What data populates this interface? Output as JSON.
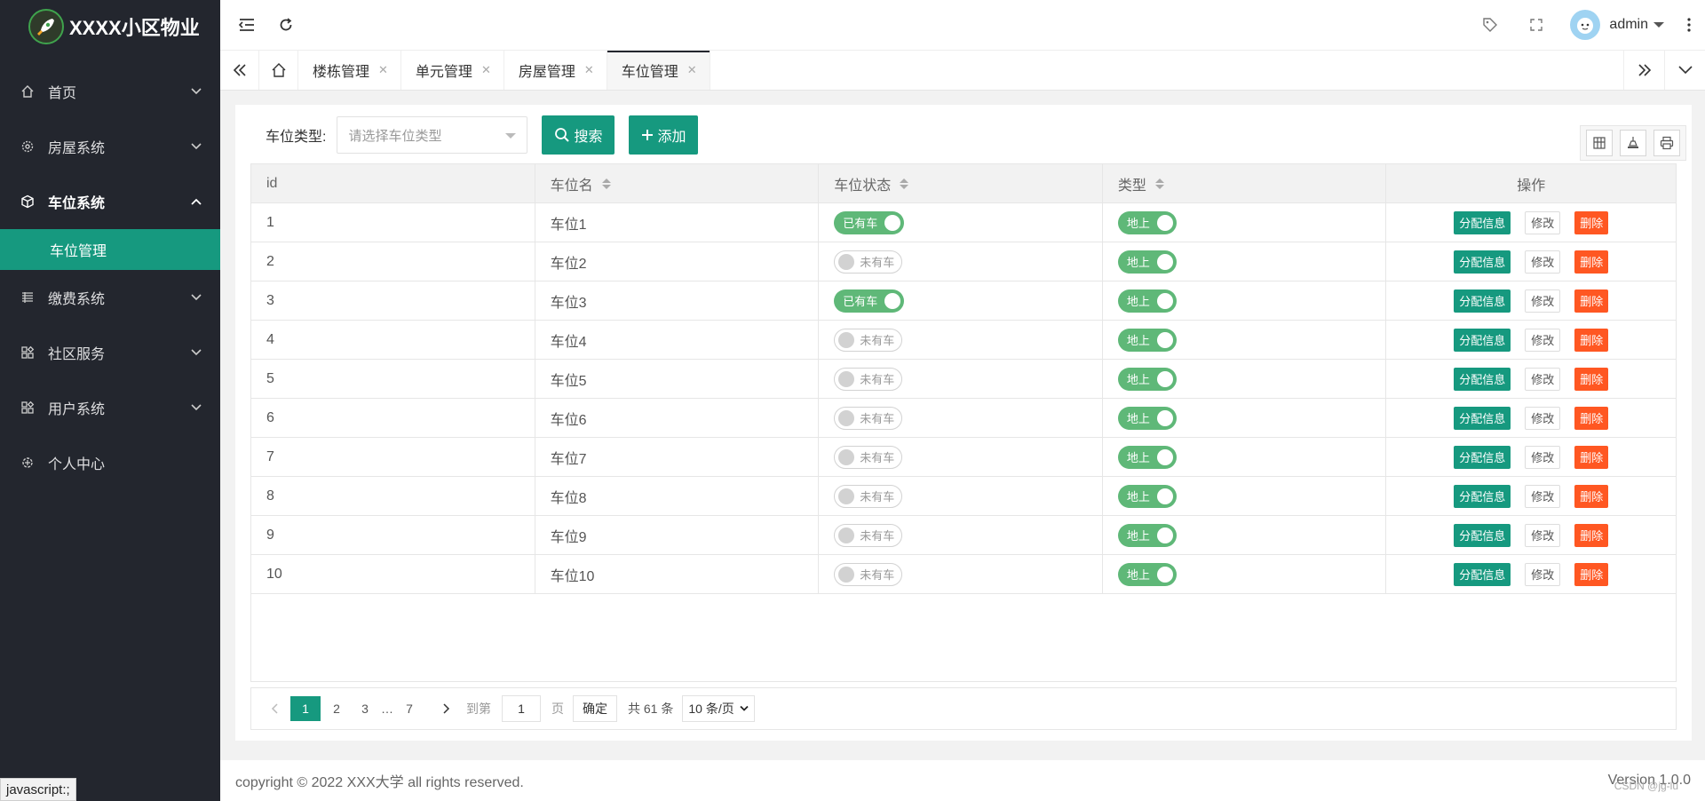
{
  "app": {
    "title": "XXXX小区物业"
  },
  "sidebar": {
    "items": [
      {
        "label": "首页",
        "icon": "home-icon",
        "arrow": "down"
      },
      {
        "label": "房屋系统",
        "icon": "gear-icon",
        "arrow": "down"
      },
      {
        "label": "车位系统",
        "icon": "cube-icon",
        "arrow": "up"
      },
      {
        "label": "缴费系统",
        "icon": "list-icon",
        "arrow": "down"
      },
      {
        "label": "社区服务",
        "icon": "apps-icon",
        "arrow": "down"
      },
      {
        "label": "用户系统",
        "icon": "apps-icon",
        "arrow": "down"
      },
      {
        "label": "个人中心",
        "icon": "settings-icon",
        "arrow": ""
      }
    ],
    "subitem": "车位管理"
  },
  "header": {
    "username": "admin"
  },
  "tabs": [
    {
      "label": "楼栋管理"
    },
    {
      "label": "单元管理"
    },
    {
      "label": "房屋管理"
    },
    {
      "label": "车位管理"
    }
  ],
  "search": {
    "label": "车位类型:",
    "placeholder": "请选择车位类型",
    "search_button": "搜索",
    "add_button": "添加"
  },
  "table": {
    "columns": [
      "id",
      "车位名",
      "车位状态",
      "类型",
      "操作"
    ],
    "rows": [
      {
        "id": "1",
        "name": "车位1",
        "status": "已有车",
        "status_on": true,
        "type": "地上"
      },
      {
        "id": "2",
        "name": "车位2",
        "status": "未有车",
        "status_on": false,
        "type": "地上"
      },
      {
        "id": "3",
        "name": "车位3",
        "status": "已有车",
        "status_on": true,
        "type": "地上"
      },
      {
        "id": "4",
        "name": "车位4",
        "status": "未有车",
        "status_on": false,
        "type": "地上"
      },
      {
        "id": "5",
        "name": "车位5",
        "status": "未有车",
        "status_on": false,
        "type": "地上"
      },
      {
        "id": "6",
        "name": "车位6",
        "status": "未有车",
        "status_on": false,
        "type": "地上"
      },
      {
        "id": "7",
        "name": "车位7",
        "status": "未有车",
        "status_on": false,
        "type": "地上"
      },
      {
        "id": "8",
        "name": "车位8",
        "status": "未有车",
        "status_on": false,
        "type": "地上"
      },
      {
        "id": "9",
        "name": "车位9",
        "status": "未有车",
        "status_on": false,
        "type": "地上"
      },
      {
        "id": "10",
        "name": "车位10",
        "status": "未有车",
        "status_on": false,
        "type": "地上"
      }
    ],
    "ops": {
      "assign": "分配信息",
      "edit": "修改",
      "delete": "删除"
    }
  },
  "pager": {
    "pages": [
      "1",
      "2",
      "3",
      "…",
      "7"
    ],
    "goto_label": "到第",
    "goto_value": "1",
    "page_suffix": "页",
    "confirm": "确定",
    "total": "共 61 条",
    "page_size": "10 条/页"
  },
  "footer": {
    "copyright": "copyright © 2022 XXX大学 all rights reserved.",
    "version": "Version 1.0.0"
  },
  "status_bar": "javascript:;",
  "watermark": "CSDN @jg-lu",
  "colors": {
    "sidebar": "#23262e",
    "accent": "#16997f",
    "switch_on": "#5fb878",
    "danger": "#ff5722"
  }
}
